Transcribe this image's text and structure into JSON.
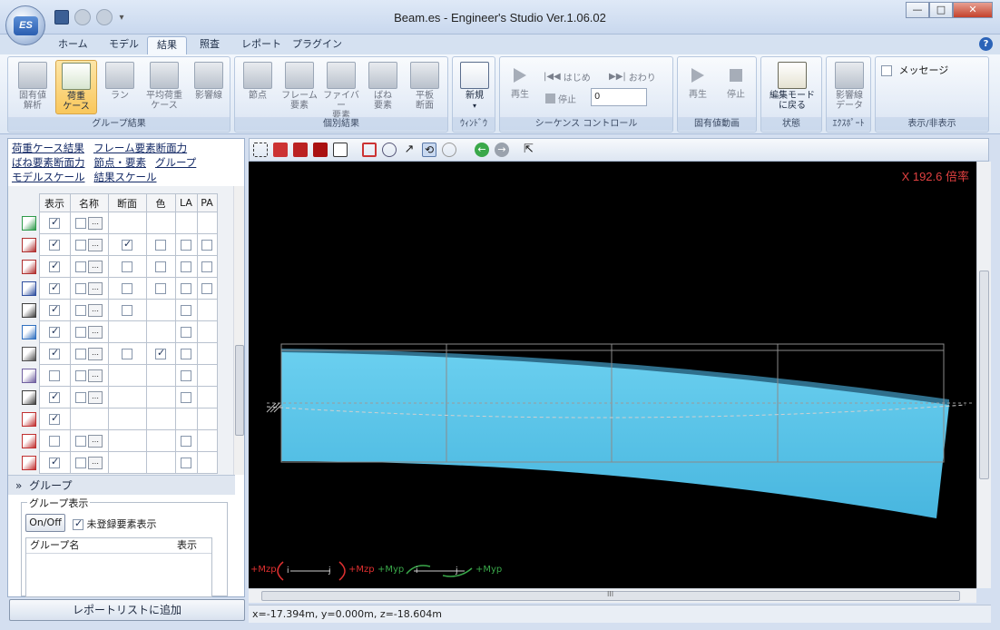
{
  "window": {
    "title": "Beam.es - Engineer's Studio Ver.1.06.02",
    "logo_text": "ES",
    "controls": {
      "minimize": "—",
      "maximize": "□",
      "close": "✕"
    }
  },
  "ribbon_tabs": [
    "ホーム",
    "モデル",
    "結果",
    "照査",
    "レポート",
    "プラグイン"
  ],
  "active_tab": "結果",
  "ribbon_groups": {
    "group_results": {
      "label": "グループ結果",
      "buttons": [
        "固有値\n解析",
        "荷重\nケース",
        "ラン",
        "平均荷重\nケース",
        "影響線"
      ]
    },
    "individual_results": {
      "label": "個別結果",
      "buttons": [
        "節点",
        "フレーム\n要素",
        "ファイバー\n要素",
        "ばね\n要素",
        "平板\n断面"
      ]
    },
    "window": {
      "label": "ｳｨﾝﾄﾞｳ",
      "new_label": "新規"
    },
    "sequence": {
      "label": "シーケンス コントロール",
      "play": "再生",
      "start": "はじめ",
      "end": "おわり",
      "stop": "停止",
      "frame_value": "0"
    },
    "eigen_anim": {
      "label": "固有値動画",
      "play": "再生",
      "stop": "停止"
    },
    "state": {
      "label": "状態",
      "back": "編集モード\nに戻る"
    },
    "export": {
      "label": "ｴｸｽﾎﾟｰﾄ",
      "button": "影響線\nデータ"
    },
    "display": {
      "label": "表示/非表示",
      "message": "メッセージ"
    }
  },
  "left_panel": {
    "links": [
      [
        "荷重ケース結果",
        "フレーム要素断面力"
      ],
      [
        "ばね要素断面力",
        "節点・要素",
        "グループ"
      ],
      [
        "モデルスケール",
        "結果スケール"
      ]
    ],
    "table_headers": [
      "表示",
      "名称",
      "断面",
      "色",
      "LA",
      "PA"
    ],
    "rows": [
      {
        "icon": "node-icon",
        "color": "#2e9a4a",
        "show": true,
        "name_btn": true,
        "section": null,
        "color_chk": null,
        "la": null,
        "pa": null
      },
      {
        "icon": "frame-element-icon",
        "color": "#b03030",
        "show": true,
        "name_btn": true,
        "section": true,
        "color_chk": false,
        "la": false,
        "pa": false
      },
      {
        "icon": "fiber-element-icon",
        "color": "#b03030",
        "show": true,
        "name_btn": true,
        "section": false,
        "color_chk": false,
        "la": false,
        "pa": false
      },
      {
        "icon": "spring-element-icon",
        "color": "#3050a0",
        "show": true,
        "name_btn": true,
        "section": false,
        "color_chk": false,
        "la": false,
        "pa": false
      },
      {
        "icon": "rigid-element-icon",
        "color": "#404040",
        "show": true,
        "name_btn": true,
        "section": false,
        "color_chk": null,
        "la": false,
        "pa": null
      },
      {
        "icon": "link-element-icon",
        "color": "#3070c0",
        "show": true,
        "name_btn": true,
        "section": null,
        "color_chk": null,
        "la": false,
        "pa": null
      },
      {
        "icon": "plate-element-icon",
        "color": "#505050",
        "show": true,
        "name_btn": true,
        "section": false,
        "color_chk": true,
        "la": false,
        "pa": null
      },
      {
        "icon": "plate-section-icon",
        "color": "#7060a0",
        "show": false,
        "name_btn": true,
        "section": null,
        "color_chk": null,
        "la": false,
        "pa": null
      },
      {
        "icon": "support-icon",
        "color": "#404040",
        "show": true,
        "name_btn": true,
        "section": null,
        "color_chk": null,
        "la": false,
        "pa": null
      },
      {
        "icon": "load-icon",
        "color": "#c03030",
        "show": true,
        "name_btn": null,
        "section": null,
        "color_chk": null,
        "la": null,
        "pa": null
      },
      {
        "icon": "axis-icon",
        "color": "#c03030",
        "show": false,
        "name_btn": true,
        "section": null,
        "color_chk": null,
        "la": false,
        "pa": null
      },
      {
        "icon": "local-axis-icon",
        "color": "#c03030",
        "show": true,
        "name_btn": true,
        "section": null,
        "color_chk": null,
        "la": false,
        "pa": null
      }
    ],
    "group_header": "グループ",
    "group_box_legend": "グループ表示",
    "onoff_label": "On/Off",
    "unregistered_label": "未登録要素表示",
    "group_list_headers": [
      "グループ名",
      "表示"
    ],
    "add_report_label": "レポートリストに追加"
  },
  "viewport": {
    "scale_label": "X 192.6 倍率",
    "legend": {
      "mzp_left": "+Mzp",
      "mzp_right": "+Mzp",
      "myp_left": "+Myp",
      "myp_right": "+Myp",
      "node_i": "i",
      "node_j": "j"
    },
    "colors": {
      "fill": "#5bc6ea",
      "fill_dark": "#3a8fb0",
      "mzp": "#e03030",
      "myp": "#3aa84a"
    }
  },
  "scroll": {
    "hscroll_mid": "III"
  },
  "status": {
    "coordinates": "x=-17.394m, y=0.000m, z=-18.604m"
  }
}
